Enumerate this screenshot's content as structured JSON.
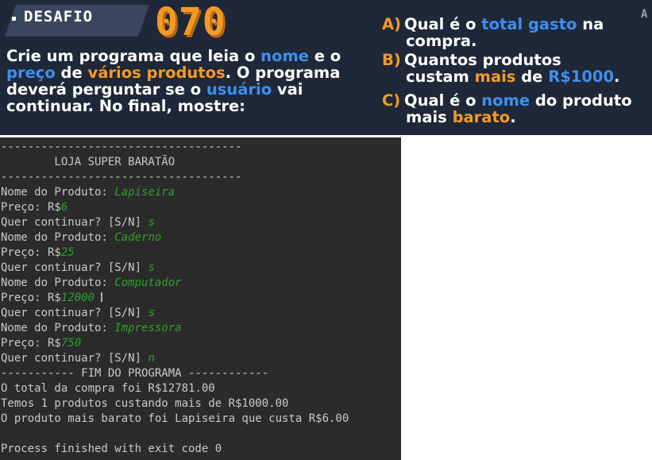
{
  "banner": {
    "tag": "DESAFIO",
    "number": "070",
    "corner_char": "A",
    "desc": {
      "t1": "Crie um programa que leia o ",
      "t2": "nome",
      "t3": " e o",
      "t4": "preço",
      "t5": " de ",
      "t6": "vários produtos",
      "t7": ". O programa",
      "t8": "deverá perguntar se o ",
      "t9": "usuário",
      "t10": " vai",
      "t11": "continuar. No final, mostre:"
    },
    "qa": {
      "letter": "A)",
      "p1": "Qual é o ",
      "p2": "total gasto",
      "p3": " na",
      "p4": "compra."
    },
    "qb": {
      "letter": "B)",
      "p1": "Quantos produtos",
      "p2": "custam ",
      "p3": "mais",
      "p4": " de ",
      "p5": "R$1000",
      "p6": "."
    },
    "qc": {
      "letter": "C)",
      "p1": "Qual é o ",
      "p2": "nome",
      "p3": " do produto",
      "p4": "mais ",
      "p5": "barato",
      "p6": "."
    }
  },
  "terminal": {
    "rule": "------------------------------------",
    "store_title": "        LOJA SUPER BARATÃO",
    "prompt_name": "Nome do Produto: ",
    "prompt_price": "Preço: R$",
    "prompt_continue": "Quer continuar? [S/N] ",
    "entries": [
      {
        "name": "Lapiseira",
        "price": "6",
        "answer": "s"
      },
      {
        "name": "Caderno",
        "price": "25",
        "answer": "s"
      },
      {
        "name": "Computador",
        "price": "12000",
        "answer": "s"
      },
      {
        "name": "Impressora",
        "price": "750",
        "answer": "n"
      }
    ],
    "end_line": "----------- FIM DO PROGRAMA ------------",
    "result_total": "O total da compra foi R$12781.00",
    "result_count": "Temos 1 produtos custando mais de R$1000.00",
    "result_cheapest": "O produto mais barato foi Lapiseira que custa R$6.00",
    "exit_line": "Process finished with exit code 0"
  }
}
